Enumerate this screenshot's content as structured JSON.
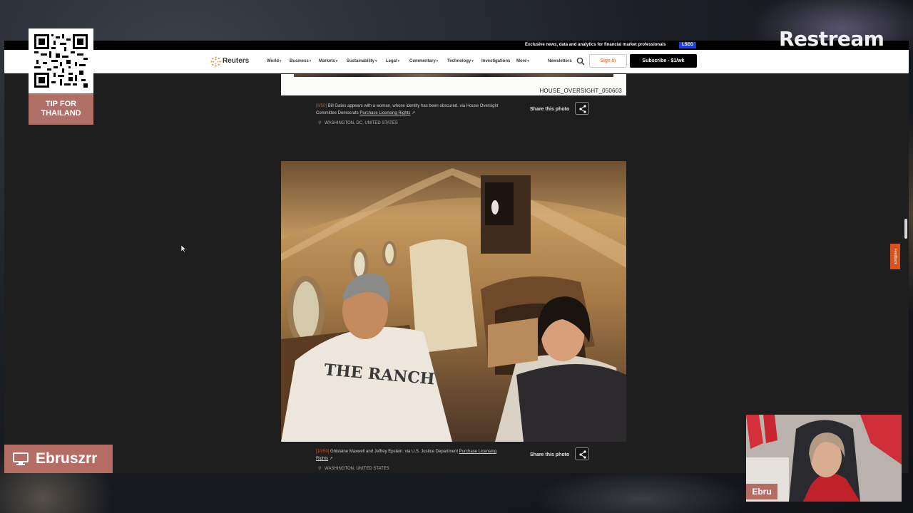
{
  "promo": {
    "text": "Exclusive news, data and analytics for financial market professionals",
    "badge": "LSEG"
  },
  "nav": {
    "brand": "Reuters",
    "items": [
      "World",
      "Business",
      "Markets",
      "Sustainability",
      "Legal",
      "Commentary",
      "Technology",
      "Investigations",
      "More"
    ],
    "newsletters": "Newsletters",
    "signin": "Sign In",
    "subscribe": "Subscribe - $1/wk"
  },
  "photo1": {
    "id_label": "HOUSE_OVERSIGHT_050603",
    "index": "[9/50]",
    "caption": "Bill Gates appears with a woman, whose identity has been obscured. via House Oversight",
    "caption2": "Committee Democrats",
    "license": "Purchase Licensing Rights",
    "location": "WASHINGTON, DC, UNITED STATES",
    "share": "Share this photo"
  },
  "photo2": {
    "index": "[10/50]",
    "caption": "Ghislaine Maxwell and Jeffrey Epstein. via U.S. Justice Department",
    "license_part1": "Purchase Licensing",
    "license_part2": "Rights",
    "location": "WASHINGTON, UNITED STATES",
    "share": "Share this photo",
    "sweatshirt_text": "THE RANCH"
  },
  "feedback": "Feedback",
  "overlay": {
    "qr_label_line1": "TIP FOR",
    "qr_label_line2": "THAILAND",
    "restream": "Restream",
    "channel": "Ebruszrr",
    "cam_name": "Ebru"
  },
  "colors": {
    "accent": "#d9531e",
    "badge": "#b56d63",
    "lseg": "#1e3cdc"
  }
}
